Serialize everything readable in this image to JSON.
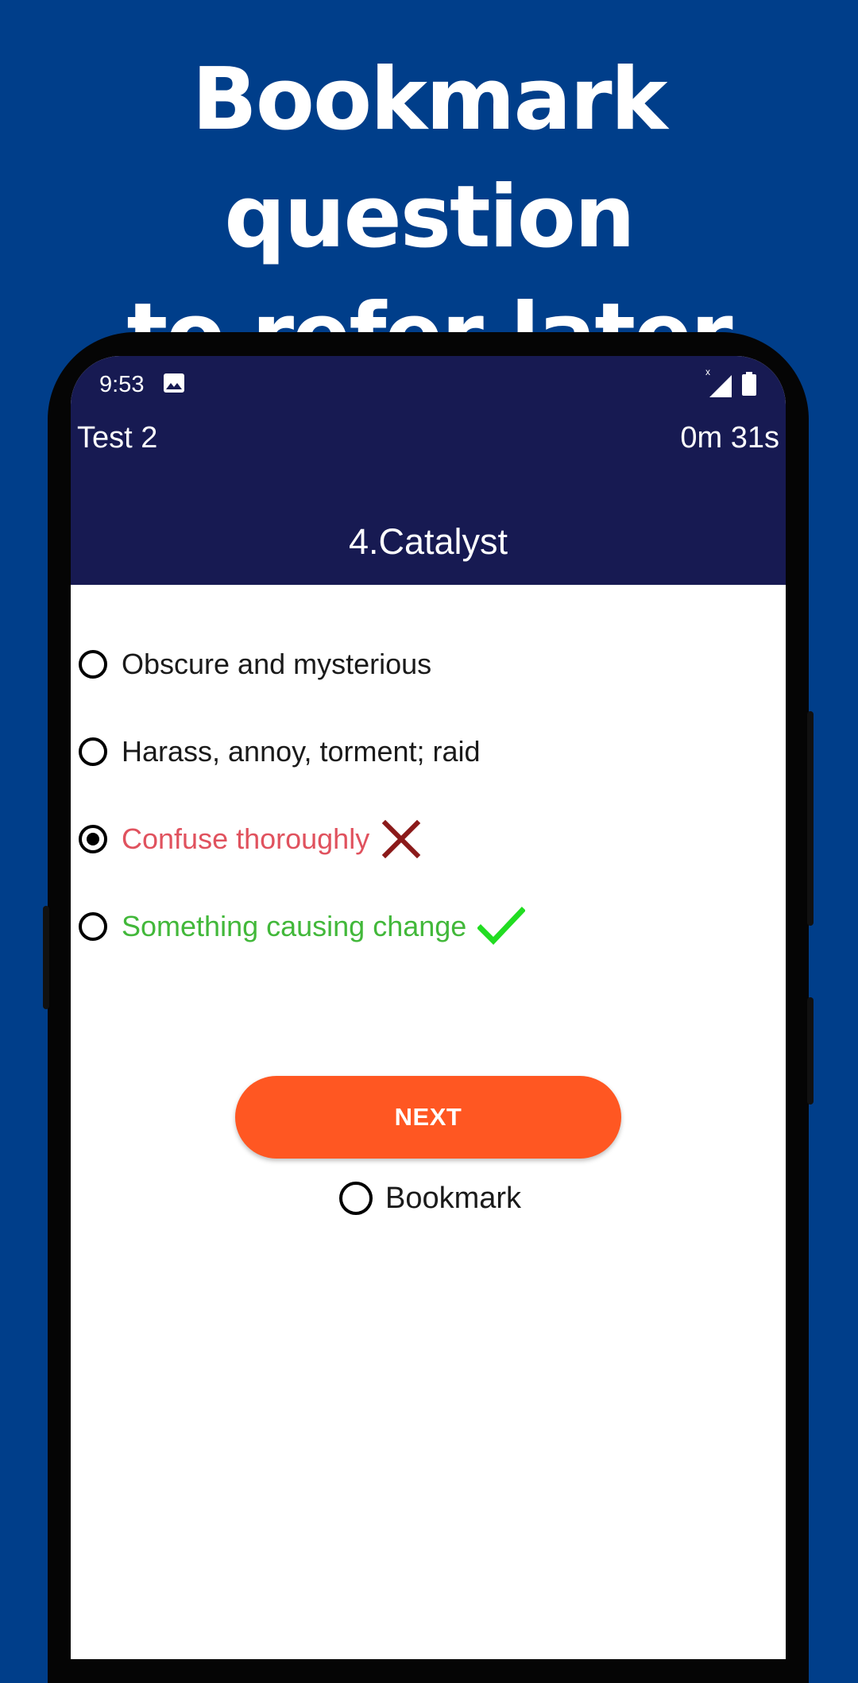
{
  "promo": {
    "headline_line1": "Bookmark question",
    "headline_line2": "to refer later"
  },
  "status_bar": {
    "time": "9:53",
    "icons": [
      "image-icon",
      "signal-icon",
      "battery-icon"
    ]
  },
  "app_bar": {
    "test_title": "Test 2",
    "timer": "0m 31s",
    "question": "4.Catalyst",
    "color": "#171a52"
  },
  "options": [
    {
      "label": "Obscure and mysterious",
      "selected": false,
      "state": "neutral"
    },
    {
      "label": "Harass, annoy, torment; raid",
      "selected": false,
      "state": "neutral"
    },
    {
      "label": "Confuse thoroughly",
      "selected": true,
      "state": "wrong",
      "mark_icon": "cross-icon"
    },
    {
      "label": "Something causing change",
      "selected": false,
      "state": "correct",
      "mark_icon": "check-icon"
    }
  ],
  "next_button": {
    "label": "NEXT",
    "color": "#ff5722"
  },
  "bookmark": {
    "label": "Bookmark",
    "checked": false
  },
  "colors": {
    "background": "#003e8a",
    "wrong": "#e0525e",
    "correct": "#42b83a",
    "cross_mark": "#8b1a1a",
    "check_mark": "#22dd22"
  }
}
